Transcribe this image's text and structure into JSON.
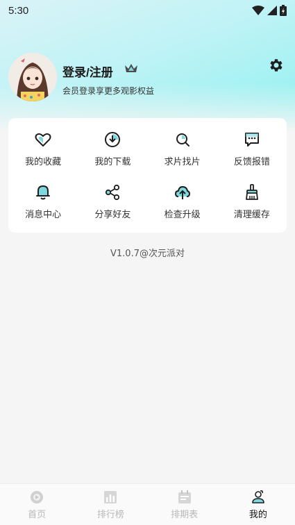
{
  "status_bar": {
    "time": "5:30"
  },
  "profile": {
    "title": "登录/注册",
    "subtitle": "会员登录享更多观影权益"
  },
  "menu": {
    "items": [
      {
        "label": "我的收藏",
        "icon": "heart-icon"
      },
      {
        "label": "我的下载",
        "icon": "download-icon"
      },
      {
        "label": "求片找片",
        "icon": "search-film-icon"
      },
      {
        "label": "反馈报错",
        "icon": "feedback-icon"
      },
      {
        "label": "消息中心",
        "icon": "bell-icon"
      },
      {
        "label": "分享好友",
        "icon": "share-icon"
      },
      {
        "label": "检查升级",
        "icon": "upgrade-icon"
      },
      {
        "label": "清理缓存",
        "icon": "clean-icon"
      }
    ]
  },
  "version": "V1.0.7@次元派对",
  "tabbar": {
    "tabs": [
      {
        "label": "首页",
        "icon": "home-icon"
      },
      {
        "label": "排行榜",
        "icon": "ranking-icon"
      },
      {
        "label": "排期表",
        "icon": "calendar-icon"
      },
      {
        "label": "我的",
        "icon": "profile-icon",
        "active": true
      }
    ]
  },
  "colors": {
    "accent": "#5fd6df",
    "header_start": "#dbf3f7",
    "header_end": "#8ff0f0"
  }
}
